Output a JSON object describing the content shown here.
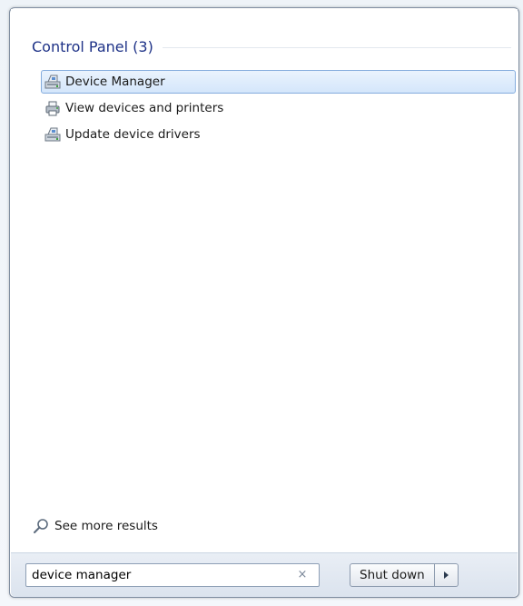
{
  "results": {
    "group_title": "Control Panel (3)",
    "items": [
      {
        "label": "Device Manager",
        "icon": "device-manager-icon",
        "selected": true
      },
      {
        "label": "View devices and printers",
        "icon": "devices-printers-icon",
        "selected": false
      },
      {
        "label": "Update device drivers",
        "icon": "device-manager-icon",
        "selected": false
      }
    ],
    "see_more_label": "See more results"
  },
  "search": {
    "value": "device manager",
    "clear_glyph": "×"
  },
  "shutdown": {
    "label": "Shut down"
  },
  "colors": {
    "group_title": "#1e3287",
    "selection_border": "#84acdd",
    "selection_fill": "#d4e6fb"
  }
}
